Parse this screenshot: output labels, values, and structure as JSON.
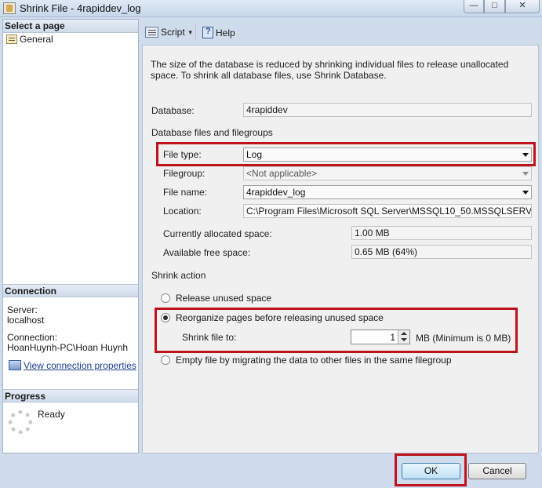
{
  "window": {
    "title": "Shrink File - 4rapiddev_log",
    "minimize": "—",
    "maximize": "□",
    "close": "✕"
  },
  "left": {
    "select_page": "Select a page",
    "pages": [
      "General"
    ],
    "connection_header": "Connection",
    "server_label": "Server:",
    "server_value": "localhost",
    "connection_label": "Connection:",
    "connection_value": "HoanHuynh-PC\\Hoan Huynh",
    "view_link": "View connection properties",
    "progress_header": "Progress",
    "progress_status": "Ready"
  },
  "toolbar": {
    "script": "Script",
    "help": "Help"
  },
  "main": {
    "description": "The size of the database is reduced by shrinking individual files to release unallocated space. To shrink all database files, use Shrink Database.",
    "database_label": "Database:",
    "database_value": "4rapiddev",
    "files_group_label": "Database files and filegroups",
    "file_type_label": "File type:",
    "file_type_value": "Log",
    "filegroup_label": "Filegroup:",
    "filegroup_value": "<Not applicable>",
    "file_name_label": "File name:",
    "file_name_value": "4rapiddev_log",
    "location_label": "Location:",
    "location_value": "C:\\Program Files\\Microsoft SQL Server\\MSSQL10_50.MSSQLSERVER\\MS",
    "allocated_label": "Currently allocated space:",
    "allocated_value": "1.00 MB",
    "free_label": "Available free space:",
    "free_value": "0.65 MB (64%)",
    "shrink_action_label": "Shrink action",
    "release_label": "Release unused space",
    "reorganize_label": "Reorganize pages before releasing unused space",
    "shrink_to_label": "Shrink file to:",
    "shrink_to_value": "1",
    "shrink_unit": "MB (Minimum is 0 MB)",
    "empty_label": "Empty file by migrating the data to other files in the same filegroup",
    "selected_action": "reorganize"
  },
  "buttons": {
    "ok": "OK",
    "cancel": "Cancel"
  },
  "colors": {
    "highlight": "#c0121b",
    "titlebar": "#c7d7ea"
  }
}
